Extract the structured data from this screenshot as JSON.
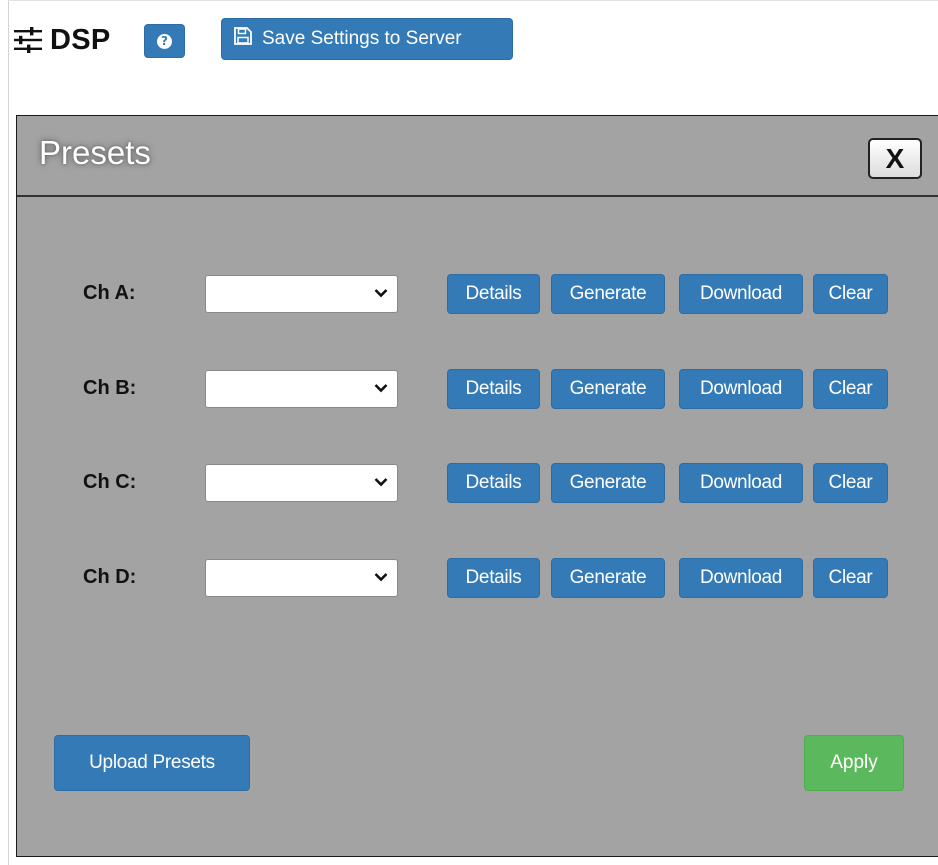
{
  "header": {
    "title": "DSP",
    "help_icon": "question-circle-icon",
    "settings_icon": "sliders-icon",
    "save_icon": "floppy-disk-icon",
    "save_label": "Save Settings to Server"
  },
  "modal": {
    "title": "Presets",
    "close_label": "X",
    "channels": [
      {
        "label": "Ch A:",
        "selected": ""
      },
      {
        "label": "Ch B:",
        "selected": ""
      },
      {
        "label": "Ch C:",
        "selected": ""
      },
      {
        "label": "Ch D:",
        "selected": ""
      }
    ],
    "buttons": {
      "details": "Details",
      "generate": "Generate",
      "download": "Download",
      "clear": "Clear"
    },
    "upload_label": "Upload Presets",
    "apply_label": "Apply"
  },
  "colors": {
    "primary": "#337ab7",
    "success": "#5cb85c",
    "modal_bg": "#a3a3a3"
  }
}
